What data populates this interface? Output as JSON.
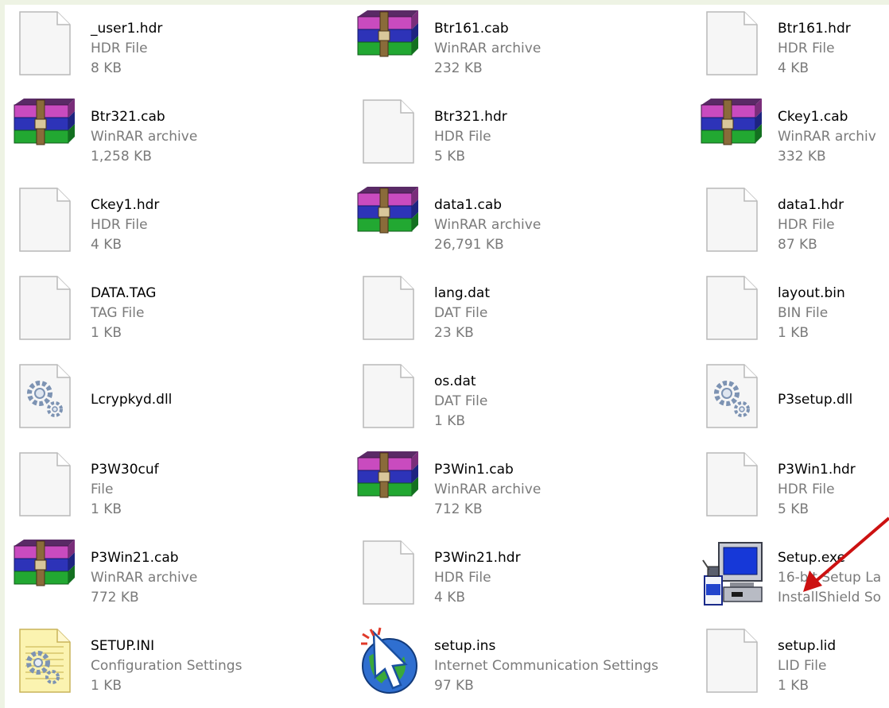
{
  "files": [
    {
      "name": "_user1.hdr",
      "type": "HDR File",
      "size": "8 KB",
      "icon": "blank-file-icon"
    },
    {
      "name": "Btr161.cab",
      "type": "WinRAR archive",
      "size": "232 KB",
      "icon": "winrar-archive-icon"
    },
    {
      "name": "Btr161.hdr",
      "type": "HDR File",
      "size": "4 KB",
      "icon": "blank-file-icon"
    },
    {
      "name": "Btr321.cab",
      "type": "WinRAR archive",
      "size": "1,258 KB",
      "icon": "winrar-archive-icon"
    },
    {
      "name": "Btr321.hdr",
      "type": "HDR File",
      "size": "5 KB",
      "icon": "blank-file-icon"
    },
    {
      "name": "Ckey1.cab",
      "type": "WinRAR archiv",
      "size": "332 KB",
      "icon": "winrar-archive-icon"
    },
    {
      "name": "Ckey1.hdr",
      "type": "HDR File",
      "size": "4 KB",
      "icon": "blank-file-icon"
    },
    {
      "name": "data1.cab",
      "type": "WinRAR archive",
      "size": "26,791 KB",
      "icon": "winrar-archive-icon"
    },
    {
      "name": "data1.hdr",
      "type": "HDR File",
      "size": "87 KB",
      "icon": "blank-file-icon"
    },
    {
      "name": "DATA.TAG",
      "type": "TAG File",
      "size": "1 KB",
      "icon": "blank-file-icon"
    },
    {
      "name": "lang.dat",
      "type": "DAT File",
      "size": "23 KB",
      "icon": "blank-file-icon"
    },
    {
      "name": "layout.bin",
      "type": "BIN File",
      "size": "1 KB",
      "icon": "blank-file-icon"
    },
    {
      "name": "Lcrypkyd.dll",
      "type": "",
      "size": "",
      "icon": "dll-gear-icon"
    },
    {
      "name": "os.dat",
      "type": "DAT File",
      "size": "1 KB",
      "icon": "blank-file-icon"
    },
    {
      "name": "P3setup.dll",
      "type": "",
      "size": "",
      "icon": "dll-gear-icon"
    },
    {
      "name": "P3W30cuf",
      "type": "File",
      "size": "1 KB",
      "icon": "blank-file-icon"
    },
    {
      "name": "P3Win1.cab",
      "type": "WinRAR archive",
      "size": "712 KB",
      "icon": "winrar-archive-icon"
    },
    {
      "name": "P3Win1.hdr",
      "type": "HDR File",
      "size": "5 KB",
      "icon": "blank-file-icon"
    },
    {
      "name": "P3Win21.cab",
      "type": "WinRAR archive",
      "size": "772 KB",
      "icon": "winrar-archive-icon"
    },
    {
      "name": "P3Win21.hdr",
      "type": "HDR File",
      "size": "4 KB",
      "icon": "blank-file-icon"
    },
    {
      "name": "Setup.exe",
      "type": "16-bit Setup La",
      "size": "InstallShield So",
      "icon": "installshield-setup-icon"
    },
    {
      "name": "SETUP.INI",
      "type": "Configuration Settings",
      "size": "1 KB",
      "icon": "config-settings-icon"
    },
    {
      "name": "setup.ins",
      "type": "Internet Communication Settings",
      "size": "97 KB",
      "icon": "internet-settings-icon"
    },
    {
      "name": "setup.lid",
      "type": "LID File",
      "size": "1 KB",
      "icon": "blank-file-icon"
    }
  ],
  "colors": {
    "window_border": "#eef3e4",
    "name_text": "#000000",
    "detail_text": "#7a7a7a",
    "annotation_arrow": "#cc1111"
  }
}
